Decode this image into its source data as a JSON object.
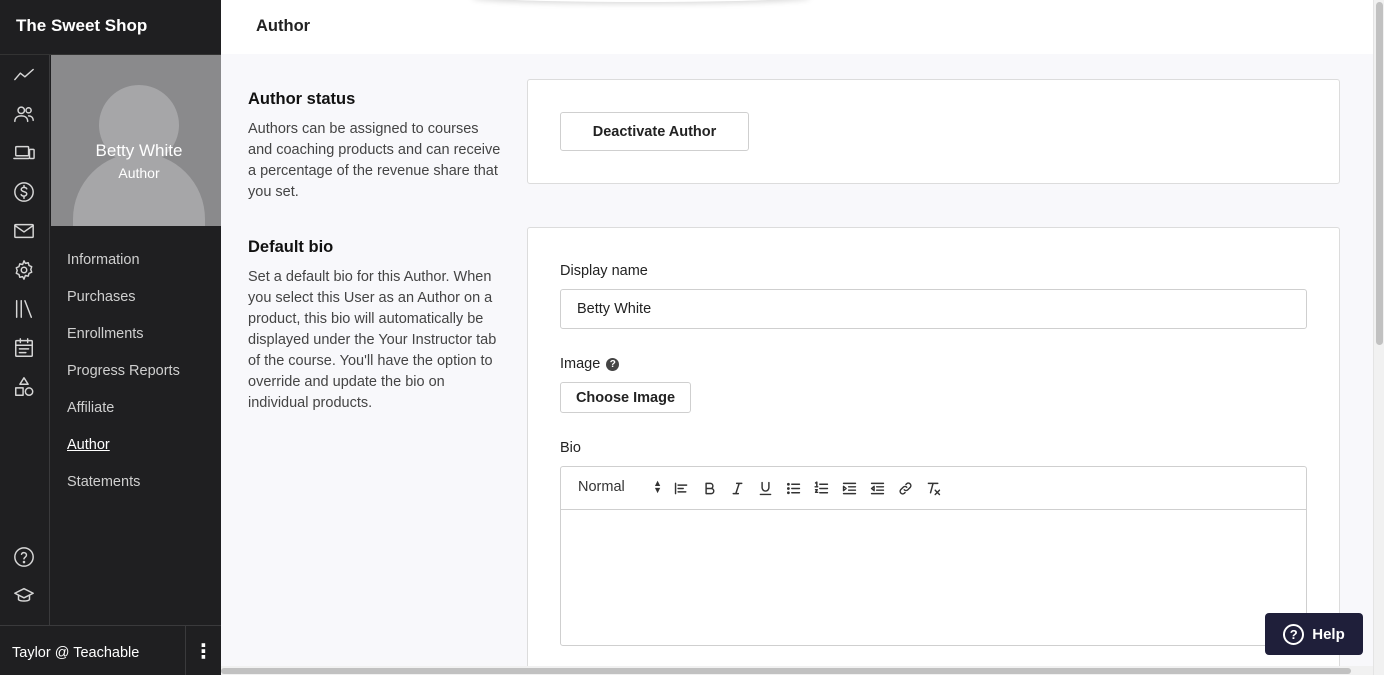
{
  "app": {
    "school_name": "The Sweet Shop"
  },
  "rail_icons": [
    "analytics-icon",
    "users-icon",
    "devices-icon",
    "dollar-icon",
    "mail-icon",
    "settings-icon",
    "library-icon",
    "calendar-icon",
    "shapes-icon",
    "help-circle-icon",
    "graduation-cap-icon"
  ],
  "profile": {
    "name": "Betty White",
    "role": "Author"
  },
  "subnav": {
    "items": [
      {
        "label": "Information"
      },
      {
        "label": "Purchases"
      },
      {
        "label": "Enrollments"
      },
      {
        "label": "Progress Reports"
      },
      {
        "label": "Affiliate"
      },
      {
        "label": "Author",
        "active": true
      },
      {
        "label": "Statements"
      }
    ]
  },
  "account": {
    "label": "Taylor @ Teachable",
    "menu_glyph": "⋮"
  },
  "header": {
    "title": "Author"
  },
  "author_status": {
    "title": "Author status",
    "description": "Authors can be assigned to courses and coaching products and can receive a percentage of the revenue share that you set.",
    "deactivate_label": "Deactivate Author"
  },
  "default_bio": {
    "title": "Default bio",
    "description": "Set a default bio for this Author. When you select this User as an Author on a product, this bio will automatically be displayed under the Your Instructor tab of the course. You'll have the option to override and update the bio on individual products.",
    "display_name_label": "Display name",
    "display_name_value": "Betty White",
    "image_label": "Image",
    "image_help_glyph": "?",
    "choose_image_label": "Choose Image",
    "bio_label": "Bio",
    "format_value": "Normal",
    "format_arrows": "▲▼",
    "bio_value": ""
  },
  "toolbar_icons": [
    "align-left-icon",
    "bold-icon",
    "italic-icon",
    "underline-icon",
    "bullet-list-icon",
    "ordered-list-icon",
    "indent-icon",
    "outdent-icon",
    "link-icon",
    "clear-format-icon"
  ],
  "help_button": {
    "label": "Help",
    "glyph": "?"
  }
}
